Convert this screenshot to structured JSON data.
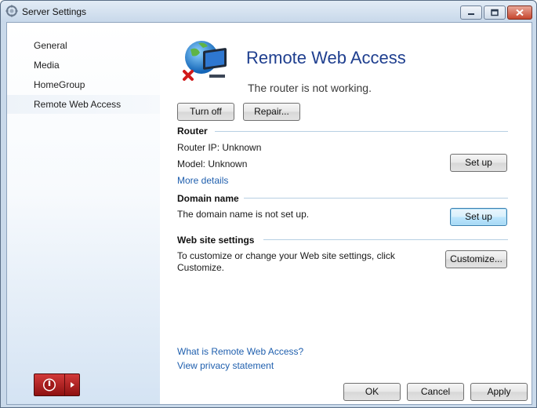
{
  "window": {
    "title": "Server Settings",
    "controls": {
      "minimize": "minimize-icon",
      "maximize": "maximize-icon",
      "close": "close-icon"
    }
  },
  "sidebar": {
    "items": [
      {
        "label": "General",
        "selected": false
      },
      {
        "label": "Media",
        "selected": false
      },
      {
        "label": "HomeGroup",
        "selected": false
      },
      {
        "label": "Remote Web Access",
        "selected": true
      }
    ],
    "power_icon": "power-icon",
    "power_menu_icon": "arrow-right-icon"
  },
  "header": {
    "title": "Remote Web Access",
    "status": "The router is not working.",
    "icon": "globe-computer-error-icon"
  },
  "actions": {
    "turn_off": "Turn off",
    "repair": "Repair..."
  },
  "router": {
    "heading": "Router",
    "ip": "Router IP: Unknown",
    "model": "Model: Unknown",
    "more_details": "More details",
    "setup_label": "Set up"
  },
  "domain": {
    "heading": "Domain name",
    "status": "The domain name is not set up.",
    "setup_label": "Set up"
  },
  "website": {
    "heading": "Web site settings",
    "description": "To customize or change your Web site settings, click Customize.",
    "customize_label": "Customize..."
  },
  "links": {
    "what_is": "What is Remote Web Access?",
    "privacy": "View privacy statement"
  },
  "footer": {
    "ok": "OK",
    "cancel": "Cancel",
    "apply": "Apply"
  },
  "colors": {
    "accent_title": "#1f3f8f",
    "link": "#1f5fae",
    "power": "#c02020"
  }
}
